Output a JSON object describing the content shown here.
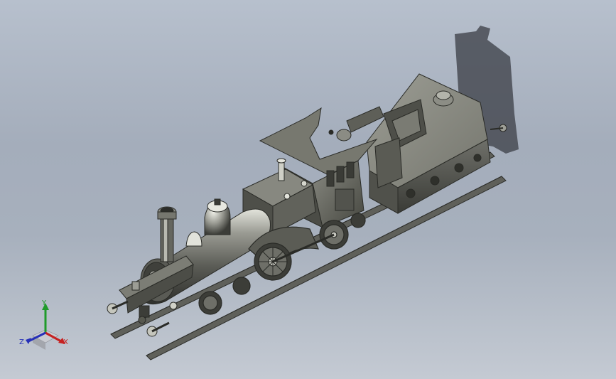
{
  "viewport": {
    "background_top": "#b7c0cd",
    "background_bottom": "#c4cad3",
    "model_body_color": "#6a6b64",
    "model_highlight_color": "#d7d8cf",
    "shadow_color": "#474a52"
  },
  "model": {
    "description_icon": "steam-locomotive-model",
    "shadow_icon": "model-shadow"
  },
  "triad": {
    "y_label": "Y",
    "x_label": "X",
    "z_label": "Z",
    "y_color": "#1f9b2a",
    "x_color": "#c62121",
    "z_color": "#2630b8"
  }
}
